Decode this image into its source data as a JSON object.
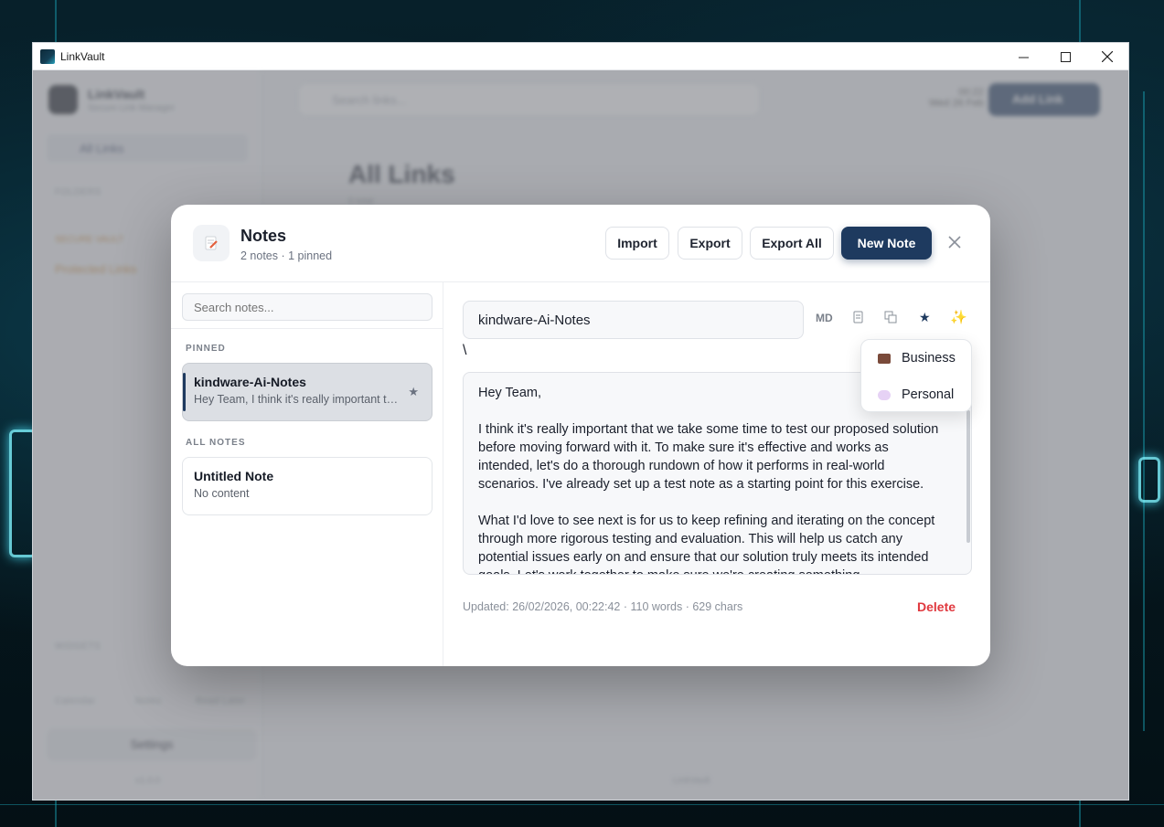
{
  "window": {
    "title": "LinkVault"
  },
  "background_app": {
    "brand": "LinkVault",
    "brand_sub": "Secure Link Manager",
    "nav_all_links": "All Links",
    "folders_label": "FOLDERS",
    "secure_vault_label": "SECURE VAULT",
    "protected_label": "Protected Links",
    "search_placeholder": "Search links...",
    "time": "00:22",
    "date": "Wed 26 Feb",
    "add_link": "Add Link",
    "heading": "All Links",
    "heading_sub": "0 total",
    "widgets_label": "WIDGETS",
    "widget_1": "Calendar",
    "widget_2": "Notes",
    "widget_3": "Read Later",
    "settings": "Settings",
    "footer_left": "v1.0.0",
    "footer_right": "LinkVault"
  },
  "modal": {
    "title": "Notes",
    "subtitle": "2 notes · 1 pinned",
    "buttons": {
      "import": "Import",
      "export": "Export",
      "export_all": "Export All",
      "new_note": "New Note"
    },
    "close": "✕",
    "search_placeholder": "Search notes...",
    "sections": {
      "pinned": "PINNED",
      "all": "ALL NOTES"
    },
    "pinned_notes": [
      {
        "title": "kindware-Ai-Notes",
        "snippet": "Hey Team, I think it's really important that we take some time to test our proposed solution"
      }
    ],
    "all_notes": [
      {
        "title": "Untitled Note",
        "snippet": "No content"
      }
    ],
    "editor": {
      "title_value": "kindware-Ai-Notes",
      "tool_md": "MD",
      "stray_text": "\\",
      "paragraphs": [
        "Hey Team,",
        "I think it's really important that we take some time to test our proposed solution before moving forward with it. To make sure it's effective and works as intended, let's do a thorough rundown of how it performs in real-world scenarios. I've already set up a test note as a starting point for this exercise.",
        "What I'd love to see next is for us to keep refining and iterating on the concept through more rigorous testing and evaluation. This will help us catch any potential issues early on and ensure that our solution truly meets its intended goals. Let's work together to make sure we're creating something"
      ],
      "meta": "Updated: 26/02/2026, 00:22:42 · 110 words · 629 chars",
      "delete": "Delete"
    },
    "category_menu": [
      {
        "label": "Business",
        "color": "#7a4a3a"
      },
      {
        "label": "Personal",
        "color": "#c9a0e8"
      }
    ]
  }
}
